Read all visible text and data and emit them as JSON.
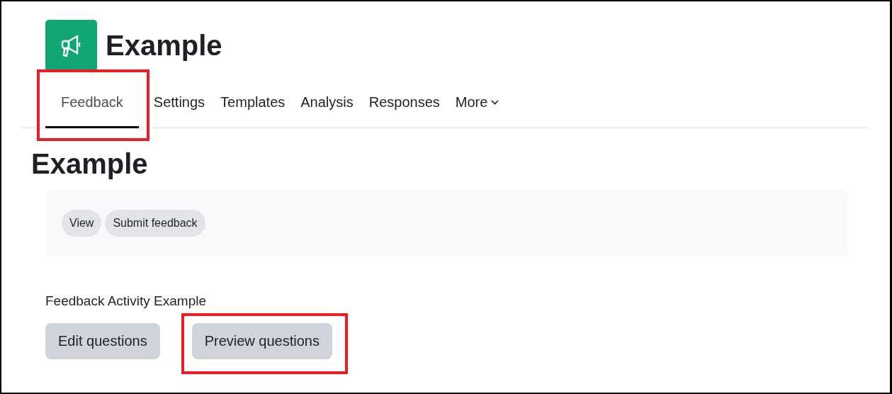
{
  "header": {
    "title": "Example"
  },
  "tabs": [
    {
      "label": "Feedback",
      "selected": true,
      "highlighted": true
    },
    {
      "label": "Settings",
      "selected": false,
      "highlighted": false
    },
    {
      "label": "Templates",
      "selected": false,
      "highlighted": false
    },
    {
      "label": "Analysis",
      "selected": false,
      "highlighted": false
    },
    {
      "label": "Responses",
      "selected": false,
      "highlighted": false
    },
    {
      "label": "More",
      "selected": false,
      "highlighted": false,
      "kind": "dropdown"
    }
  ],
  "heading": "Example",
  "action_pills": [
    "View",
    "Submit feedback"
  ],
  "description": "Feedback Activity Example",
  "buttons": [
    {
      "label": "Edit questions",
      "highlighted": false
    },
    {
      "label": "Preview questions",
      "highlighted": true
    }
  ]
}
